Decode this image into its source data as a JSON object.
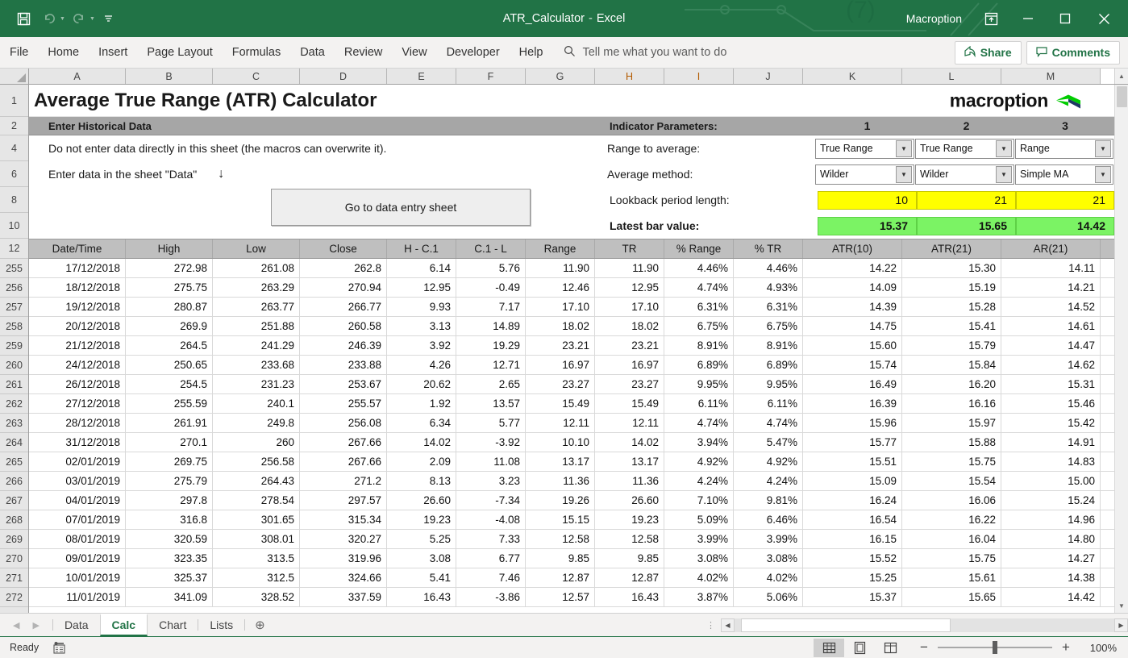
{
  "titlebar": {
    "filename": "ATR_Calculator",
    "separator": "-",
    "app": "Excel",
    "account": "Macroption",
    "save_icon": "save-icon",
    "undo_icon": "undo-icon",
    "redo_icon": "redo-icon",
    "customize_icon": "customize-quick-access-icon",
    "ribbon_display_icon": "ribbon-display-options-icon",
    "minimize_icon": "minimize-icon",
    "maximize_icon": "maximize-icon",
    "close_icon": "close-icon"
  },
  "ribbon": {
    "tabs": [
      "File",
      "Home",
      "Insert",
      "Page Layout",
      "Formulas",
      "Data",
      "Review",
      "View",
      "Developer",
      "Help"
    ],
    "tellme_placeholder": "Tell me what you want to do",
    "share_label": "Share",
    "comments_label": "Comments"
  },
  "columns": [
    {
      "letter": "A",
      "width": 120,
      "selected": false
    },
    {
      "letter": "B",
      "width": 108,
      "selected": false
    },
    {
      "letter": "C",
      "width": 108,
      "selected": false
    },
    {
      "letter": "D",
      "width": 108,
      "selected": false
    },
    {
      "letter": "E",
      "width": 86,
      "selected": false
    },
    {
      "letter": "F",
      "width": 86,
      "selected": false
    },
    {
      "letter": "G",
      "width": 86,
      "selected": false
    },
    {
      "letter": "H",
      "width": 86,
      "selected": true
    },
    {
      "letter": "I",
      "width": 86,
      "selected": true
    },
    {
      "letter": "J",
      "width": 86,
      "selected": false
    },
    {
      "letter": "K",
      "width": 123,
      "selected": false
    },
    {
      "letter": "L",
      "width": 123,
      "selected": false
    },
    {
      "letter": "M",
      "width": 123,
      "selected": false
    }
  ],
  "row_headers": [
    "1",
    "2",
    "4",
    "6",
    "8",
    "10",
    "12",
    "255",
    "256",
    "257",
    "258",
    "259",
    "260",
    "261",
    "262",
    "263",
    "264",
    "265",
    "266",
    "267",
    "268",
    "269",
    "270",
    "271",
    "272"
  ],
  "sheet": {
    "title": "Average True Range (ATR) Calculator",
    "logo_text": "macroption",
    "band_left": "Enter Historical Data",
    "note1": "Do not enter data directly in this sheet (the macros can overwrite it).",
    "note2": "Enter data in the sheet \"Data\"",
    "note2_arrow": "↓",
    "goto_button": "Go to data entry sheet",
    "params_label": "Indicator Parameters:",
    "param_numbers": [
      "1",
      "2",
      "3"
    ],
    "rows": [
      {
        "label": "Range to average:",
        "bold": false,
        "type": "dropdown",
        "values": [
          "True Range",
          "True Range",
          "Range"
        ]
      },
      {
        "label": "Average method:",
        "bold": false,
        "type": "dropdown",
        "values": [
          "Wilder",
          "Wilder",
          "Simple MA"
        ]
      },
      {
        "label": "Lookback period length:",
        "bold": false,
        "type": "yellow",
        "values": [
          "10",
          "21",
          "21"
        ]
      },
      {
        "label": "Latest bar value:",
        "bold": true,
        "type": "green",
        "values": [
          "15.37",
          "15.65",
          "14.42"
        ]
      }
    ]
  },
  "table": {
    "headers": [
      "Date/Time",
      "High",
      "Low",
      "Close",
      "H - C.1",
      "C.1 - L",
      "Range",
      "TR",
      "% Range",
      "% TR",
      "ATR(10)",
      "ATR(21)",
      "AR(21)"
    ],
    "rows": [
      [
        "17/12/2018",
        "272.98",
        "261.08",
        "262.8",
        "6.14",
        "5.76",
        "11.90",
        "11.90",
        "4.46%",
        "4.46%",
        "14.22",
        "15.30",
        "14.11"
      ],
      [
        "18/12/2018",
        "275.75",
        "263.29",
        "270.94",
        "12.95",
        "-0.49",
        "12.46",
        "12.95",
        "4.74%",
        "4.93%",
        "14.09",
        "15.19",
        "14.21"
      ],
      [
        "19/12/2018",
        "280.87",
        "263.77",
        "266.77",
        "9.93",
        "7.17",
        "17.10",
        "17.10",
        "6.31%",
        "6.31%",
        "14.39",
        "15.28",
        "14.52"
      ],
      [
        "20/12/2018",
        "269.9",
        "251.88",
        "260.58",
        "3.13",
        "14.89",
        "18.02",
        "18.02",
        "6.75%",
        "6.75%",
        "14.75",
        "15.41",
        "14.61"
      ],
      [
        "21/12/2018",
        "264.5",
        "241.29",
        "246.39",
        "3.92",
        "19.29",
        "23.21",
        "23.21",
        "8.91%",
        "8.91%",
        "15.60",
        "15.79",
        "14.47"
      ],
      [
        "24/12/2018",
        "250.65",
        "233.68",
        "233.88",
        "4.26",
        "12.71",
        "16.97",
        "16.97",
        "6.89%",
        "6.89%",
        "15.74",
        "15.84",
        "14.62"
      ],
      [
        "26/12/2018",
        "254.5",
        "231.23",
        "253.67",
        "20.62",
        "2.65",
        "23.27",
        "23.27",
        "9.95%",
        "9.95%",
        "16.49",
        "16.20",
        "15.31"
      ],
      [
        "27/12/2018",
        "255.59",
        "240.1",
        "255.57",
        "1.92",
        "13.57",
        "15.49",
        "15.49",
        "6.11%",
        "6.11%",
        "16.39",
        "16.16",
        "15.46"
      ],
      [
        "28/12/2018",
        "261.91",
        "249.8",
        "256.08",
        "6.34",
        "5.77",
        "12.11",
        "12.11",
        "4.74%",
        "4.74%",
        "15.96",
        "15.97",
        "15.42"
      ],
      [
        "31/12/2018",
        "270.1",
        "260",
        "267.66",
        "14.02",
        "-3.92",
        "10.10",
        "14.02",
        "3.94%",
        "5.47%",
        "15.77",
        "15.88",
        "14.91"
      ],
      [
        "02/01/2019",
        "269.75",
        "256.58",
        "267.66",
        "2.09",
        "11.08",
        "13.17",
        "13.17",
        "4.92%",
        "4.92%",
        "15.51",
        "15.75",
        "14.83"
      ],
      [
        "03/01/2019",
        "275.79",
        "264.43",
        "271.2",
        "8.13",
        "3.23",
        "11.36",
        "11.36",
        "4.24%",
        "4.24%",
        "15.09",
        "15.54",
        "15.00"
      ],
      [
        "04/01/2019",
        "297.8",
        "278.54",
        "297.57",
        "26.60",
        "-7.34",
        "19.26",
        "26.60",
        "7.10%",
        "9.81%",
        "16.24",
        "16.06",
        "15.24"
      ],
      [
        "07/01/2019",
        "316.8",
        "301.65",
        "315.34",
        "19.23",
        "-4.08",
        "15.15",
        "19.23",
        "5.09%",
        "6.46%",
        "16.54",
        "16.22",
        "14.96"
      ],
      [
        "08/01/2019",
        "320.59",
        "308.01",
        "320.27",
        "5.25",
        "7.33",
        "12.58",
        "12.58",
        "3.99%",
        "3.99%",
        "16.15",
        "16.04",
        "14.80"
      ],
      [
        "09/01/2019",
        "323.35",
        "313.5",
        "319.96",
        "3.08",
        "6.77",
        "9.85",
        "9.85",
        "3.08%",
        "3.08%",
        "15.52",
        "15.75",
        "14.27"
      ],
      [
        "10/01/2019",
        "325.37",
        "312.5",
        "324.66",
        "5.41",
        "7.46",
        "12.87",
        "12.87",
        "4.02%",
        "4.02%",
        "15.25",
        "15.61",
        "14.38"
      ],
      [
        "11/01/2019",
        "341.09",
        "328.52",
        "337.59",
        "16.43",
        "-3.86",
        "12.57",
        "16.43",
        "3.87%",
        "5.06%",
        "15.37",
        "15.65",
        "14.42"
      ]
    ]
  },
  "sheet_tabs": {
    "items": [
      "Data",
      "Calc",
      "Chart",
      "Lists"
    ],
    "active": "Calc",
    "add_label": "⊕",
    "prev_icon": "previous-sheet-icon",
    "next_icon": "next-sheet-icon"
  },
  "statusbar": {
    "status": "Ready",
    "macro_icon": "record-macro-icon",
    "view_normal_icon": "normal-view-icon",
    "view_layout_icon": "page-layout-view-icon",
    "view_pagebreak_icon": "page-break-preview-icon",
    "zoom_out": "−",
    "zoom_in": "+",
    "zoom_level": "100%"
  },
  "colors": {
    "excel_green": "#217346",
    "band_gray": "#a6a6a6",
    "header_gray": "#bfbfbf",
    "yellow": "#ffff00",
    "green_cell": "#7bf364"
  }
}
